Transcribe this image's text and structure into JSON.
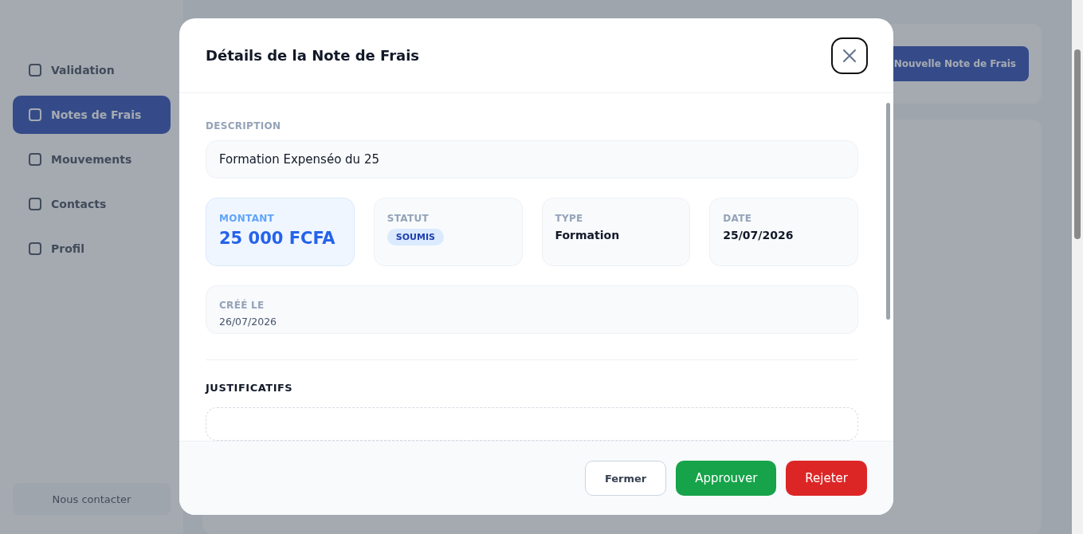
{
  "sidebar": {
    "items": [
      {
        "label": "Validation",
        "selected": false
      },
      {
        "label": "Notes de Frais",
        "selected": true
      },
      {
        "label": "Mouvements",
        "selected": false
      },
      {
        "label": "Contacts",
        "selected": false
      },
      {
        "label": "Profil",
        "selected": false
      }
    ],
    "contact_button": "Nous contacter"
  },
  "page": {
    "new_button": "Nouvelle Note de Frais"
  },
  "modal": {
    "title": "Détails de la Note de Frais",
    "description_label": "DESCRIPTION",
    "description": "Formation Expenséo du 25",
    "fields": [
      {
        "kind": "amount",
        "label": "MONTANT",
        "value": "25 000 FCFA"
      },
      {
        "kind": "badge",
        "label": "STATUT",
        "value": "SOUMIS"
      },
      {
        "kind": "text",
        "label": "TYPE",
        "value": "Formation"
      },
      {
        "kind": "text",
        "label": "DATE",
        "value": "25/07/2026"
      }
    ],
    "created_label": "CRÉÉ LE",
    "created": "26/07/2026",
    "attachments_heading": "JUSTIFICATIFS",
    "buttons": [
      {
        "kind": "secondary",
        "label": "Fermer"
      },
      {
        "kind": "approve",
        "label": "Approuver"
      },
      {
        "kind": "reject",
        "label": "Rejeter"
      }
    ]
  }
}
